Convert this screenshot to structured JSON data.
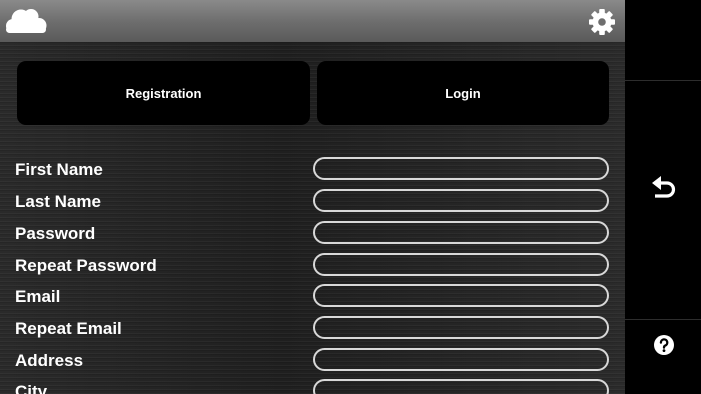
{
  "header": {
    "left_icon": "cloud-icon",
    "right_icon": "gear-icon"
  },
  "tabs": [
    {
      "label": "Registration"
    },
    {
      "label": "Login"
    }
  ],
  "form": {
    "fields": [
      {
        "label": "First Name",
        "value": ""
      },
      {
        "label": "Last Name",
        "value": ""
      },
      {
        "label": "Password",
        "value": ""
      },
      {
        "label": "Repeat Password",
        "value": ""
      },
      {
        "label": "Email",
        "value": ""
      },
      {
        "label": "Repeat Email",
        "value": ""
      },
      {
        "label": "Address",
        "value": ""
      },
      {
        "label": "City",
        "value": ""
      }
    ]
  },
  "sidebar": {
    "back_icon": "back-arrow-icon",
    "help_icon": "help-icon"
  },
  "colors": {
    "topbar": "#7a7a7a",
    "panel": "#262626",
    "tab": "#000000",
    "field_border": "#d8d8d8",
    "sidebar": "#000000"
  }
}
